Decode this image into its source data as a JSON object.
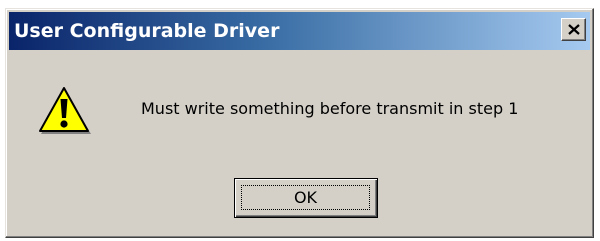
{
  "window": {
    "title": "User Configurable Driver",
    "close_icon": "close-icon"
  },
  "dialog": {
    "icon": "warning-icon",
    "message": "Must write something before transmit in step 1",
    "ok_label": "OK"
  },
  "colors": {
    "dialog_background": "#d4d0c8",
    "titlebar_start": "#0a246a",
    "titlebar_end": "#a6caf0",
    "title_text": "#ffffff",
    "warning_fill": "#ffff00"
  }
}
